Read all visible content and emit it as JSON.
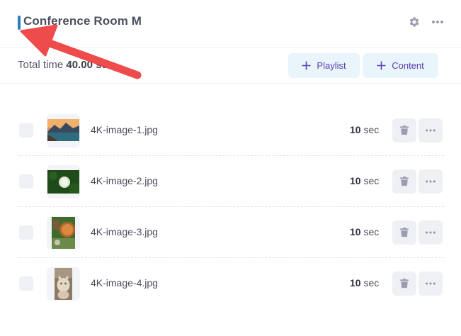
{
  "header": {
    "title": "Conference Room M",
    "accent_color": "#2b7fb8",
    "icons": [
      "gear-icon",
      "more-icon"
    ]
  },
  "toolbar": {
    "total_label": "Total time",
    "total_value": "40.00 sec",
    "playlist_label": "Playlist",
    "content_label": "Content"
  },
  "items": [
    {
      "name": "4K-image-1.jpg",
      "duration_value": "10",
      "duration_unit": "sec",
      "thumb": "mountain-lake-image"
    },
    {
      "name": "4K-image-2.jpg",
      "duration_value": "10",
      "duration_unit": "sec",
      "thumb": "dandelion-image"
    },
    {
      "name": "4K-image-3.jpg",
      "duration_value": "10",
      "duration_unit": "sec",
      "thumb": "hobbit-door-image"
    },
    {
      "name": "4K-image-4.jpg",
      "duration_value": "10",
      "duration_unit": "sec",
      "thumb": "cat-image"
    }
  ],
  "annotation": {
    "arrow_color": "#ee4b4b"
  }
}
